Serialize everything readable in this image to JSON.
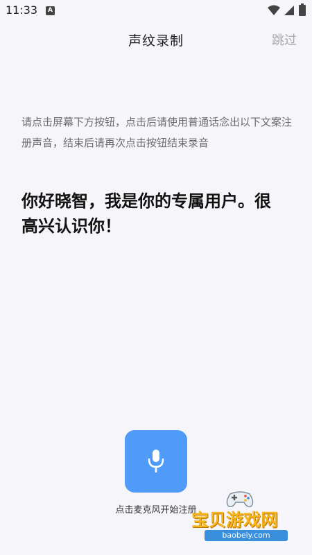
{
  "status_bar": {
    "time": "11:33",
    "notification_icon": "A"
  },
  "header": {
    "title": "声纹录制",
    "skip_label": "跳过"
  },
  "instruction_text": "请点击屏幕下方按钮，点击后请使用普通话念出以下文案注册声音，结束后请再次点击按钮结束录音",
  "phrase_text": "你好晓智，我是你的专属用户。很高兴认识你！",
  "mic": {
    "icon": "microphone-icon",
    "hint": "点击麦克风开始注册"
  },
  "watermark": {
    "brand": "宝贝游戏网",
    "url": "baobeiy.com"
  },
  "colors": {
    "background": "#f6f6fa",
    "accent": "#4f9bf7",
    "skip": "#a8a8a8"
  }
}
